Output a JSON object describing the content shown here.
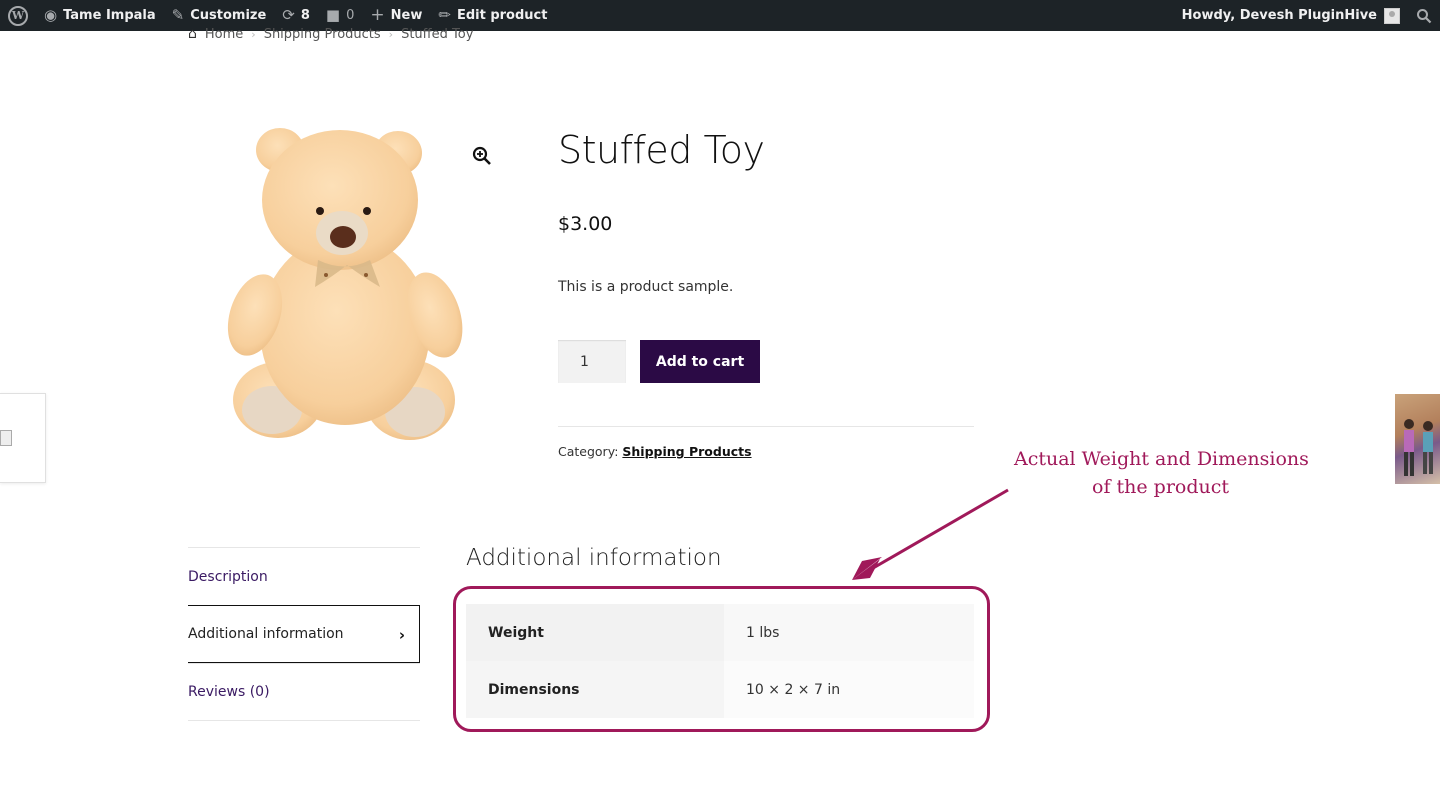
{
  "adminbar": {
    "site_name": "Tame Impala",
    "customize": "Customize",
    "updates_count": "8",
    "comments_count": "0",
    "new_label": "New",
    "edit_label": "Edit product",
    "howdy": "Howdy, Devesh PluginHive"
  },
  "breadcrumb": {
    "home": "Home",
    "category": "Shipping Products",
    "current": "Stuffed Toy"
  },
  "product": {
    "title": "Stuffed Toy",
    "price": "$3.00",
    "short_description": "This is a product sample.",
    "quantity": "1",
    "add_to_cart": "Add to cart",
    "category_label": "Category:",
    "category_link": "Shipping Products"
  },
  "tabs": [
    {
      "label": "Description"
    },
    {
      "label": "Additional information"
    },
    {
      "label": "Reviews (0)"
    }
  ],
  "additional_info": {
    "title": "Additional information",
    "rows": [
      {
        "label": "Weight",
        "value": "1 lbs"
      },
      {
        "label": "Dimensions",
        "value": "10 × 2 × 7 in"
      }
    ]
  },
  "annotation": {
    "line1": "Actual Weight and Dimensions",
    "line2": "of the product",
    "color": "#a0195a"
  },
  "colors": {
    "adminbar_bg": "#1d2327",
    "button_bg": "#2b0a45",
    "tab_link": "#3a1a63"
  }
}
